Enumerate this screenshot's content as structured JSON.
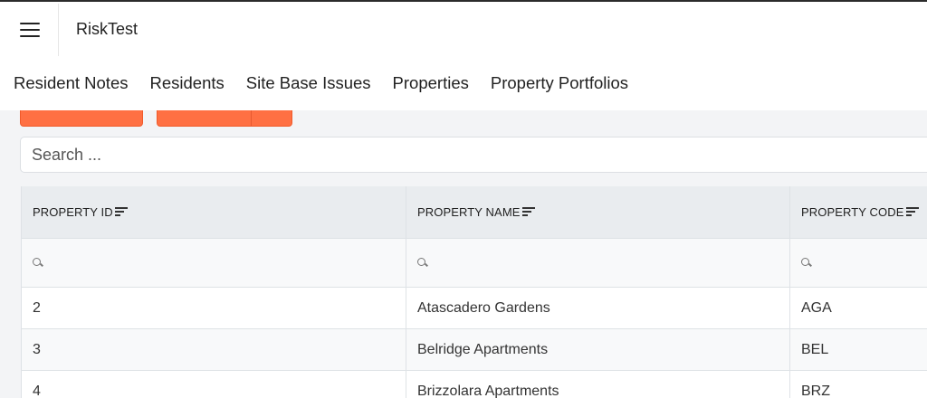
{
  "app": {
    "title": "RiskTest"
  },
  "nav": {
    "items": [
      "Resident Notes",
      "Residents",
      "Site Base Issues",
      "Properties",
      "Property Portfolios"
    ]
  },
  "search": {
    "placeholder": "Search ..."
  },
  "table": {
    "columns": [
      "PROPERTY ID",
      "PROPERTY NAME",
      "PROPERTY CODE"
    ],
    "rows": [
      [
        "2",
        "Atascadero Gardens",
        "AGA"
      ],
      [
        "3",
        "Belridge Apartments",
        "BEL"
      ],
      [
        "4",
        "Brizzolara Apartments",
        "BRZ"
      ]
    ]
  },
  "colors": {
    "accent": "#ff7043",
    "header_bg": "#e9ecef"
  },
  "icons": {
    "menu": "hamburger-icon",
    "sort": "sort-icon",
    "filter": "magnifier-icon"
  }
}
